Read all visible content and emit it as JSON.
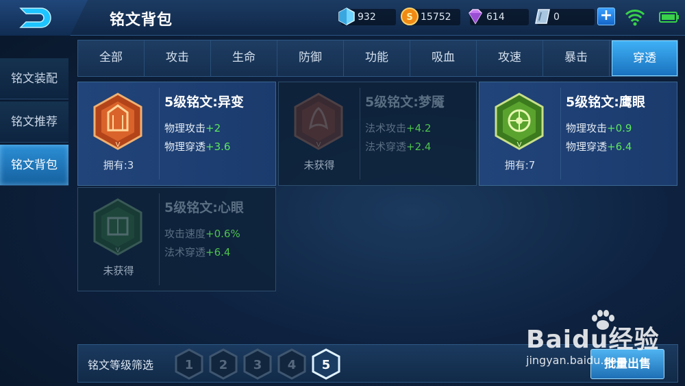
{
  "header": {
    "title": "铭文背包"
  },
  "resources": [
    {
      "icon": "crystal-icon",
      "value": "932"
    },
    {
      "icon": "gold-coin-icon",
      "value": "15752"
    },
    {
      "icon": "purple-diamond-icon",
      "value": "614"
    },
    {
      "icon": "ticket-icon",
      "value": "0"
    }
  ],
  "plus_label": "+",
  "sidebar": {
    "items": [
      {
        "label": "铭文装配"
      },
      {
        "label": "铭文推荐"
      },
      {
        "label": "铭文背包",
        "active": true
      }
    ]
  },
  "tabs": [
    {
      "label": "全部"
    },
    {
      "label": "攻击"
    },
    {
      "label": "生命"
    },
    {
      "label": "防御"
    },
    {
      "label": "功能"
    },
    {
      "label": "吸血"
    },
    {
      "label": "攻速"
    },
    {
      "label": "暴击"
    },
    {
      "label": "穿透",
      "active": true
    }
  ],
  "cards": [
    {
      "name": "5级铭文:异变",
      "owned_text": "拥有:3",
      "owned": true,
      "gem_color": "#c8501e",
      "stats": [
        {
          "label": "物理攻击",
          "value": "+2"
        },
        {
          "label": "物理穿透",
          "value": "+3.6"
        }
      ]
    },
    {
      "name": "5级铭文:梦魇",
      "owned_text": "未获得",
      "owned": false,
      "gem_color": "#b04a2a",
      "stats": [
        {
          "label": "法术攻击",
          "value": "+4.2"
        },
        {
          "label": "法术穿透",
          "value": "+2.4"
        }
      ]
    },
    {
      "name": "5级铭文:鹰眼",
      "owned_text": "拥有:7",
      "owned": true,
      "gem_color": "#4a9a2a",
      "stats": [
        {
          "label": "物理攻击",
          "value": "+0.9"
        },
        {
          "label": "物理穿透",
          "value": "+6.4"
        }
      ]
    },
    {
      "name": "5级铭文:心眼",
      "owned_text": "未获得",
      "owned": false,
      "gem_color": "#3a8a3a",
      "stats": [
        {
          "label": "攻击速度",
          "value": "+0.6%"
        },
        {
          "label": "法术穿透",
          "value": "+6.4"
        }
      ]
    }
  ],
  "filter": {
    "label": "铭文等级筛选",
    "levels": [
      "1",
      "2",
      "3",
      "4",
      "5"
    ],
    "selected": "5"
  },
  "sell_button": "批量出售",
  "watermark": {
    "big": "Baidu经验",
    "small": "jingyan.baidu.com"
  },
  "colors": {
    "accent": "#2c8fd6",
    "stat_plus": "#5ee85e"
  }
}
